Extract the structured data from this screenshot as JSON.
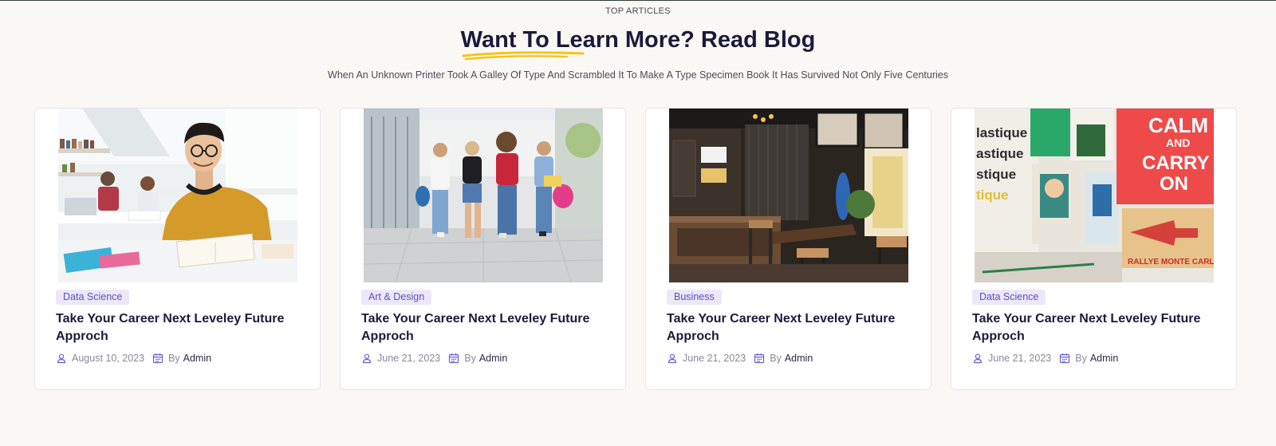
{
  "header": {
    "eyebrow": "TOP ARTICLES",
    "title": "Want To Learn More? Read Blog",
    "subtitle": "When An Unknown Printer Took A Galley Of Type And Scrambled It To Make A Type Specimen Book It Has Survived Not Only Five Centuries",
    "accent_color": "#f5c518"
  },
  "articles": [
    {
      "tag": "Data Science",
      "title": "Take Your Career Next Leveley Future Approch",
      "date": "August 10, 2023",
      "by_label": "By",
      "author": "Admin",
      "image": "student-studying-photo"
    },
    {
      "tag": "Art & Design",
      "title": "Take Your Career Next Leveley Future Approch",
      "date": "June 21, 2023",
      "by_label": "By",
      "author": "Admin",
      "image": "students-walking-photo"
    },
    {
      "tag": "Business",
      "title": "Take Your Career Next Leveley Future Approch",
      "date": "June 21, 2023",
      "by_label": "By",
      "author": "Admin",
      "image": "cafe-interior-photo"
    },
    {
      "tag": "Data Science",
      "title": "Take Your Career Next Leveley Future Approch",
      "date": "June 21, 2023",
      "by_label": "By",
      "author": "Admin",
      "image": "posters-photo",
      "image_text": [
        "lastique",
        "astique",
        "stique",
        "tique",
        "CALM",
        "AND",
        "CARRY",
        "ON",
        "RALLYE MONTE CARLO"
      ]
    }
  ],
  "colors": {
    "tag_bg": "#ece8f8",
    "tag_text": "#5b4fc6",
    "icon": "#6b5fd3",
    "title": "#1c1a3a"
  }
}
